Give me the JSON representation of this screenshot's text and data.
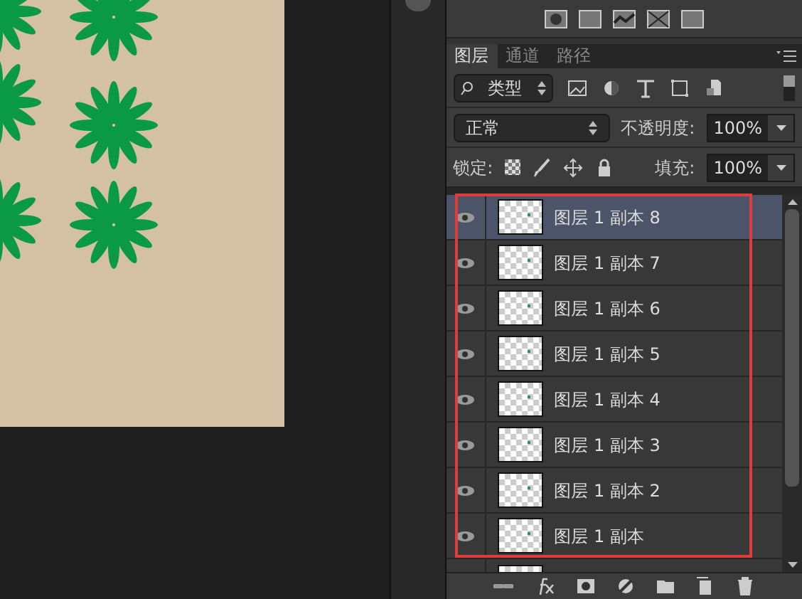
{
  "panel_tabs": [
    {
      "label": "图层",
      "selected": true
    },
    {
      "label": "通道",
      "selected": false
    },
    {
      "label": "路径",
      "selected": false
    }
  ],
  "filter": {
    "value": "类型"
  },
  "blend_mode": {
    "value": "正常"
  },
  "opacity": {
    "label": "不透明度:",
    "value": "100%"
  },
  "lock": {
    "label": "锁定:"
  },
  "fill": {
    "label": "填充:",
    "value": "100%"
  },
  "layers": [
    {
      "name": "图层 1 副本 8",
      "selected": true,
      "visible": true
    },
    {
      "name": "图层 1 副本 7",
      "selected": false,
      "visible": true
    },
    {
      "name": "图层 1 副本 6",
      "selected": false,
      "visible": true
    },
    {
      "name": "图层 1 副本 5",
      "selected": false,
      "visible": true
    },
    {
      "name": "图层 1 副本 4",
      "selected": false,
      "visible": true
    },
    {
      "name": "图层 1 副本 3",
      "selected": false,
      "visible": true
    },
    {
      "name": "图层 1 副本 2",
      "selected": false,
      "visible": true
    },
    {
      "name": "图层 1 副本",
      "selected": false,
      "visible": true
    }
  ]
}
